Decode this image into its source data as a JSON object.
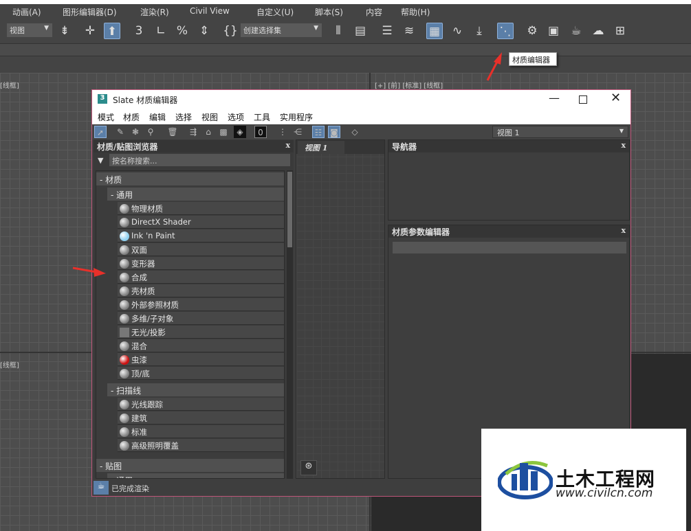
{
  "menubar": [
    "动画(A)",
    "图形编辑器(D)",
    "渲染(R)",
    "Civil View",
    "自定义(U)",
    "脚本(S)",
    "内容",
    "帮助(H)"
  ],
  "toolbar": {
    "view_dropdown": "视图",
    "selection_set_dropdown": "创建选择集"
  },
  "tooltip": "材质编辑器",
  "viewports": {
    "top_left": "[线框]",
    "top_right": "[+] [前] [标准] [线框]",
    "bottom_left": "[线框]"
  },
  "dialog": {
    "app_icon": "3",
    "title": "Slate 材质编辑器",
    "menu": [
      "模式",
      "材质",
      "编辑",
      "选择",
      "视图",
      "选项",
      "工具",
      "实用程序"
    ],
    "view_dropdown": "视图 1",
    "browser": {
      "title": "材质/贴图浏览器",
      "close": "x",
      "search_placeholder": "按名称搜索...",
      "group_materials": "- 材质",
      "sub_general": "- 通用",
      "general_items": [
        {
          "label": "物理材质",
          "swatch": "gray"
        },
        {
          "label": "DirectX Shader",
          "swatch": "gray"
        },
        {
          "label": "Ink 'n Paint",
          "swatch": "#8fd0f0"
        },
        {
          "label": "双面",
          "swatch": "gray"
        },
        {
          "label": "变形器",
          "swatch": "gray"
        },
        {
          "label": "合成",
          "swatch": "gray"
        },
        {
          "label": "壳材质",
          "swatch": "gray"
        },
        {
          "label": "外部参照材质",
          "swatch": "gray"
        },
        {
          "label": "多维/子对象",
          "swatch": "gray"
        },
        {
          "label": "无光/投影",
          "swatch": "flat"
        },
        {
          "label": "混合",
          "swatch": "gray"
        },
        {
          "label": "虫漆",
          "swatch": "#cc1111"
        },
        {
          "label": "顶/底",
          "swatch": "gray"
        }
      ],
      "sub_scanline": "- 扫描线",
      "scanline_items": [
        "光线跟踪",
        "建筑",
        "标准",
        "高级照明覆盖"
      ],
      "group_maps": "- 贴图",
      "sub_maps_general": "- 通用"
    },
    "view_tab": "视图 1",
    "navigator": {
      "title": "导航器",
      "close": "x"
    },
    "param_editor": {
      "title": "材质参数编辑器",
      "close": "x"
    },
    "status": "已完成渲染"
  },
  "watermark": {
    "name": "土木工程网",
    "url": "www.civilcn.com"
  },
  "colors": {
    "accent": "#5b7fa8",
    "annotation_arrow": "#e8302a",
    "dialog_border": "#c0567a"
  }
}
